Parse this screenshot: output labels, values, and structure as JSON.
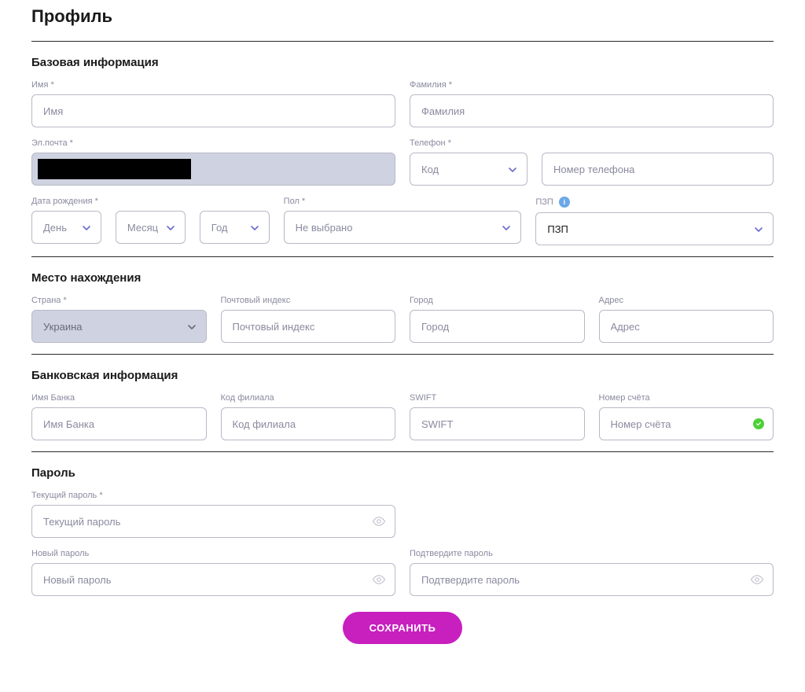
{
  "page": {
    "title": "Профиль"
  },
  "sections": {
    "basic": "Базовая информация",
    "location": "Место нахождения",
    "bank": "Банковская информация",
    "password": "Пароль"
  },
  "basic": {
    "first_name": {
      "label": "Имя *",
      "placeholder": "Имя"
    },
    "last_name": {
      "label": "Фамилия *",
      "placeholder": "Фамилия"
    },
    "email": {
      "label": "Эл.почта *"
    },
    "phone": {
      "label": "Телефон *",
      "code_placeholder": "Код",
      "number_placeholder": "Номер телефона"
    },
    "dob": {
      "label": "Дата рождения *",
      "day": "День",
      "month": "Месяц",
      "year": "Год"
    },
    "gender": {
      "label": "Пол *",
      "value": "Не выбрано"
    },
    "pzp": {
      "label": "ПЗП",
      "value": "ПЗП"
    }
  },
  "location": {
    "country": {
      "label": "Страна *",
      "value": "Украина"
    },
    "postal": {
      "label": "Почтовый индекс",
      "placeholder": "Почтовый индекс"
    },
    "city": {
      "label": "Город",
      "placeholder": "Город"
    },
    "address": {
      "label": "Адрес",
      "placeholder": "Адрес"
    }
  },
  "bank": {
    "name": {
      "label": "Имя Банка",
      "placeholder": "Имя Банка"
    },
    "branch": {
      "label": "Код филиала",
      "placeholder": "Код филиала"
    },
    "swift": {
      "label": "SWIFT",
      "placeholder": "SWIFT"
    },
    "account": {
      "label": "Номер счёта",
      "placeholder": "Номер счёта"
    }
  },
  "password": {
    "current": {
      "label": "Текущий пароль *",
      "placeholder": "Текущий пароль"
    },
    "new": {
      "label": "Новый пароль",
      "placeholder": "Новый пароль"
    },
    "confirm": {
      "label": "Подтвердите пароль",
      "placeholder": "Подтвердите пароль"
    }
  },
  "actions": {
    "save": "СОХРАНИТЬ"
  }
}
